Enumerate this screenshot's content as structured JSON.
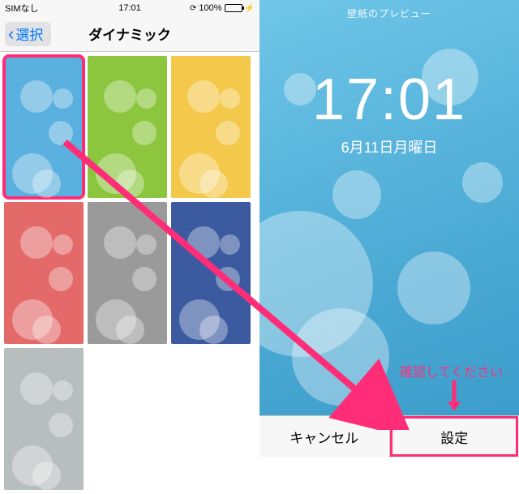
{
  "left": {
    "status": {
      "carrier": "SIMなし",
      "time": "17:01",
      "battery": "100%"
    },
    "nav": {
      "back": "選択",
      "title": "ダイナミック"
    },
    "thumbs": [
      {
        "color": "blue",
        "selected": true
      },
      {
        "color": "green",
        "selected": false
      },
      {
        "color": "yellow",
        "selected": false
      },
      {
        "color": "red",
        "selected": false
      },
      {
        "color": "gray",
        "selected": false
      },
      {
        "color": "navy",
        "selected": false
      },
      {
        "color": "lgray",
        "selected": false
      }
    ]
  },
  "right": {
    "header": "壁紙のプレビュー",
    "clock": "17:01",
    "date": "6月11日月曜日",
    "cancel": "キャンセル",
    "set": "設定"
  },
  "annotation": {
    "text": "確認してください",
    "color": "#ff2d78"
  }
}
